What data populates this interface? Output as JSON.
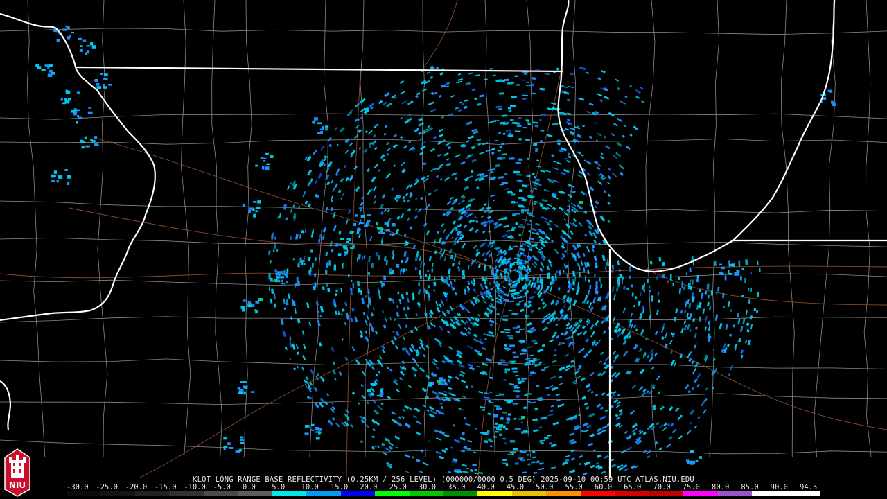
{
  "product": {
    "caption": "KLOT LONG RANGE BASE REFLECTIVITY (0.25KM / 256 LEVEL) (000000/0000 0.5 DEG) 2025-09-10 00:59 UTC  ATLAS.NIU.EDU"
  },
  "legend": {
    "labels": [
      "-30.0",
      "-25.0",
      "-20.0",
      "-15.0",
      "-10.0",
      "-5.0",
      "0.0",
      "5.0",
      "10.0",
      "15.0",
      "20.0",
      "25.0",
      "30.0",
      "35.0",
      "40.0",
      "45.0",
      "50.0",
      "55.0",
      "60.0",
      "65.0",
      "70.0",
      "75.0",
      "80.0",
      "85.0",
      "90.0",
      "94.5"
    ],
    "colors": [
      "#0a0a0a",
      "#141414",
      "#222222",
      "#323232",
      "#4a4a4a",
      "#5e5e5e",
      "#00e8e8",
      "#009cf4",
      "#0000f6",
      "#00ff00",
      "#00c800",
      "#009000",
      "#ffff00",
      "#e7c000",
      "#ff9000",
      "#ff0000",
      "#d60000",
      "#c00000",
      "#ff00ff",
      "#9955c9",
      "#ffffff",
      "#ffffff"
    ]
  },
  "logo": {
    "text": "NIU",
    "icon": "university-tower-logo",
    "color": "#c8102e"
  },
  "map": {
    "state_line_color": "#ffffff",
    "county_line_color": "#8a8a8a",
    "highway_color": "#8b4a2b",
    "echo_colors": [
      "#00c8e8",
      "#1e90ff",
      "#1060ff",
      "#00d060"
    ],
    "radar_site": "KLOT"
  }
}
